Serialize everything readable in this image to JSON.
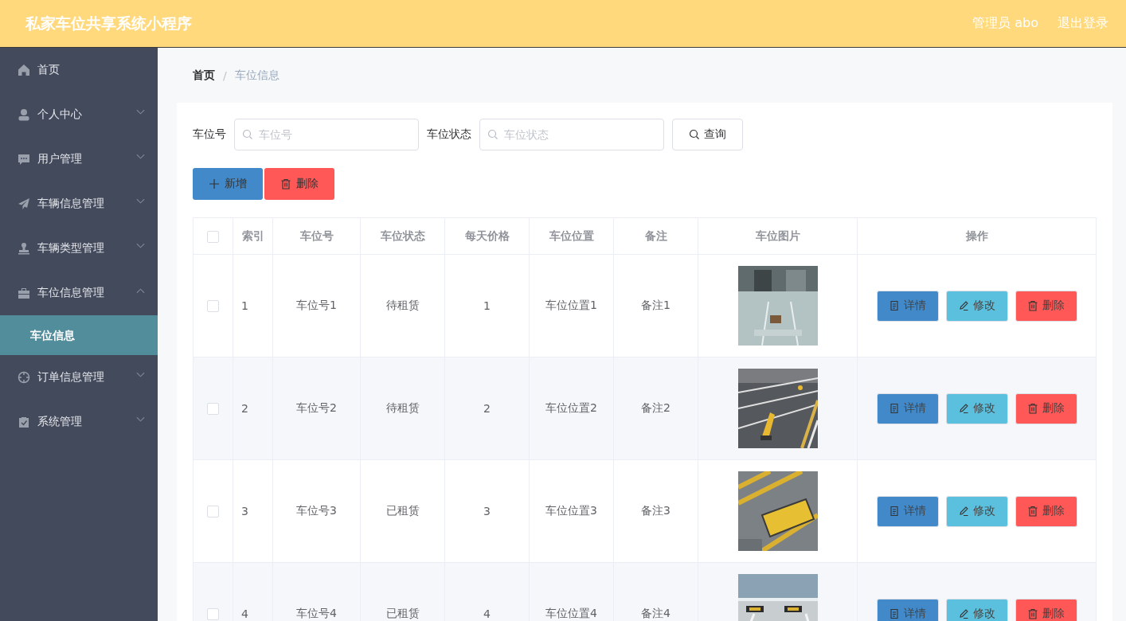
{
  "header": {
    "title": "私家车位共享系统小程序",
    "user": "管理员 abo",
    "logout": "退出登录"
  },
  "sidebar": {
    "items": [
      {
        "label": "首页",
        "selected": false
      },
      {
        "label": "个人中心",
        "selected": false,
        "expanded": false
      },
      {
        "label": "用户管理",
        "selected": false,
        "expanded": false
      },
      {
        "label": "车辆信息管理",
        "selected": false,
        "expanded": false
      },
      {
        "label": "车辆类型管理",
        "selected": false,
        "expanded": false
      },
      {
        "label": "车位信息管理",
        "selected": false,
        "expanded": true,
        "children": [
          {
            "label": "车位信息",
            "selected": true
          }
        ]
      },
      {
        "label": "订单信息管理",
        "selected": false,
        "expanded": false
      },
      {
        "label": "系统管理",
        "selected": false,
        "expanded": false
      }
    ]
  },
  "breadcrumb": {
    "items": [
      "首页",
      "车位信息"
    ],
    "separator": "/"
  },
  "search": {
    "fields": [
      {
        "label": "车位号",
        "placeholder": "车位号"
      },
      {
        "label": "车位状态",
        "placeholder": "车位状态"
      }
    ],
    "button": "查询"
  },
  "toolbar": [
    {
      "label": "新增",
      "kind": "add"
    },
    {
      "label": "删除",
      "kind": "delete"
    }
  ],
  "table": {
    "select_all": {
      "checked": false
    },
    "columns": [
      "索引",
      "车位号",
      "车位状态",
      "每天价格",
      "车位位置",
      "备注",
      "车位图片",
      "操作"
    ],
    "rows": [
      {
        "checked": false,
        "cells": [
          "1",
          "车位号1",
          "待租赁",
          "1",
          "车位位置1",
          "备注1"
        ],
        "image": {
          "kind": "picture"
        },
        "actions": [
          {
            "label": "详情",
            "kind": "detail"
          },
          {
            "label": "修改",
            "kind": "edit"
          },
          {
            "label": "删除",
            "kind": "delete"
          }
        ]
      },
      {
        "checked": false,
        "cells": [
          "2",
          "车位号2",
          "待租赁",
          "2",
          "车位位置2",
          "备注2"
        ],
        "image": {
          "kind": "picture"
        },
        "actions": [
          {
            "label": "详情",
            "kind": "detail"
          },
          {
            "label": "修改",
            "kind": "edit"
          },
          {
            "label": "删除",
            "kind": "delete"
          }
        ]
      },
      {
        "checked": false,
        "cells": [
          "3",
          "车位号3",
          "已租赁",
          "3",
          "车位位置3",
          "备注3"
        ],
        "image": {
          "kind": "picture"
        },
        "actions": [
          {
            "label": "详情",
            "kind": "detail"
          },
          {
            "label": "修改",
            "kind": "edit"
          },
          {
            "label": "删除",
            "kind": "delete"
          }
        ]
      },
      {
        "checked": false,
        "cells": [
          "4",
          "车位号4",
          "已租赁",
          "4",
          "车位位置4",
          "备注4"
        ],
        "image": {
          "kind": "picture"
        },
        "actions": [
          {
            "label": "详情",
            "kind": "detail"
          },
          {
            "label": "修改",
            "kind": "edit"
          },
          {
            "label": "删除",
            "kind": "delete"
          }
        ]
      }
    ]
  }
}
